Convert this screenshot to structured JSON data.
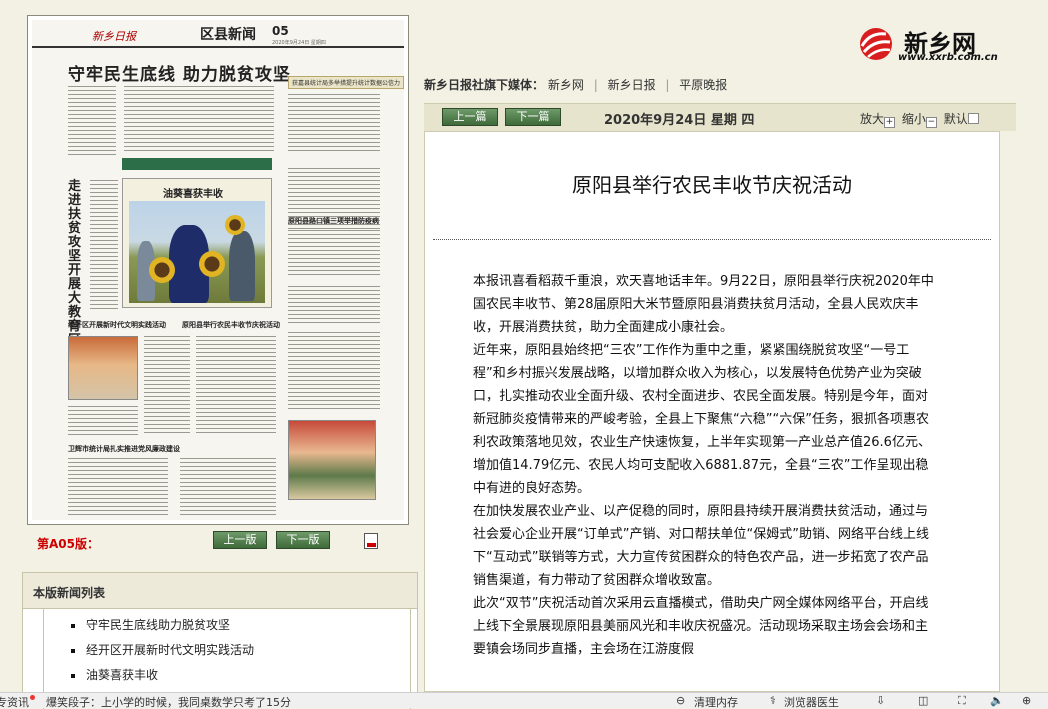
{
  "paper": {
    "logo": "新乡日报",
    "section": "区县新闻",
    "page_no": "05",
    "date_line": "2020年9月24日 星期四",
    "headline": "守牢民生底线 助力脱贫攻坚",
    "subhead": "获嘉县统计局多举措提升统计数据公信力",
    "vertical_headline": "走进扶贫攻坚开展大教育区",
    "photo_caption": "油葵喜获丰收",
    "items": [
      "经开区开展新时代文明实践活动",
      "原阳县举行农民丰收节庆祝活动",
      "卫辉市统计局扎实推进党风廉政建设",
      "原阳县路口镇三项举措防疫病"
    ]
  },
  "page_nav": {
    "label": "第A05版：",
    "prev": "上一版",
    "next": "下一版",
    "pdf_icon": "pdf-icon"
  },
  "list": {
    "header": "本版新闻列表",
    "items": [
      "守牢民生底线助力脱贫攻坚",
      "经开区开展新时代文明实践活动",
      "油葵喜获丰收"
    ]
  },
  "logo": {
    "name": "新乡网",
    "url": "www.xxrb.com.cn",
    "mark": "logo-swirl-icon"
  },
  "media": {
    "label": "新乡日报社旗下媒体：",
    "links": [
      "新乡网",
      "新乡日报",
      "平原晚报"
    ]
  },
  "toolbar": {
    "prev": "上一篇",
    "next": "下一篇",
    "date": "2020年9月24日 星期 四",
    "zoom_in": "放大",
    "zoom_out": "缩小",
    "default": "默认"
  },
  "article": {
    "title": "原阳县举行农民丰收节庆祝活动",
    "paragraphs": [
      "本报讯喜看稻菽千重浪，欢天喜地话丰年。9月22日，原阳县举行庆祝2020年中国农民丰收节、第28届原阳大米节暨原阳县消费扶贫月活动，全县人民欢庆丰收，开展消费扶贫，助力全面建成小康社会。",
      "近年来，原阳县始终把“三农”工作作为重中之重，紧紧围绕脱贫攻坚“一号工程”和乡村振兴发展战略，以增加群众收入为核心，以发展特色优势产业为突破口，扎实推动农业全面升级、农村全面进步、农民全面发展。特别是今年，面对新冠肺炎疫情带来的严峻考验，全县上下聚焦“六稳”“六保”任务，狠抓各项惠农利农政策落地见效，农业生产快速恢复，上半年实现第一产业总产值26.6亿元、增加值14.79亿元、农民人均可支配收入6881.87元，全县“三农”工作呈现出稳中有进的良好态势。",
      "在加快发展农业产业、以产促稳的同时，原阳县持续开展消费扶贫活动，通过与社会爱心企业开展“订单式”产销、对口帮扶单位“保姆式”助销、网络平台线上线下“互动式”联销等方式，大力宣传贫困群众的特色农产品，进一步拓宽了农产品销售渠道，有力带动了贫困群众增收致富。",
      "此次“双节”庆祝活动首次采用云直播模式，借助央广网全媒体网络平台，开启线上线下全景展现原阳县美丽风光和丰收庆祝盛况。活动现场采取主场会会场和主要镇会场同步直播，主会场在江游度假"
    ]
  },
  "status": {
    "left": "专资讯",
    "headline": "爆笑段子：上小学的时候，我同桌数学只考了15分",
    "clean": "清理内存",
    "doctor": "浏览器医生"
  }
}
